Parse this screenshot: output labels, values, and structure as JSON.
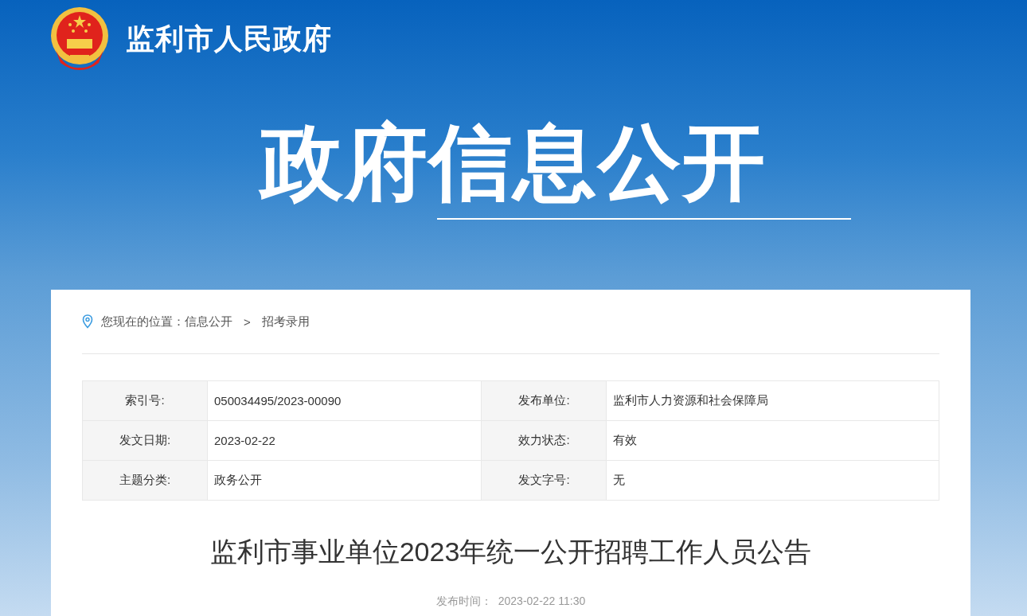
{
  "site": {
    "name": "监利市人民政府"
  },
  "banner": {
    "title": "政府信息公开"
  },
  "breadcrumb": {
    "prefix": "您现在的位置：",
    "items": [
      "信息公开",
      "招考录用"
    ],
    "separator": ">"
  },
  "meta": [
    [
      {
        "label": "索引号:",
        "value": "050034495/2023-00090"
      },
      {
        "label": "发布单位:",
        "value": "监利市人力资源和社会保障局"
      }
    ],
    [
      {
        "label": "发文日期:",
        "value": "2023-02-22"
      },
      {
        "label": "效力状态:",
        "value": "有效"
      }
    ],
    [
      {
        "label": "主题分类:",
        "value": "政务公开"
      },
      {
        "label": "发文字号:",
        "value": "无"
      }
    ]
  ],
  "article": {
    "title": "监利市事业单位2023年统一公开招聘工作人员公告",
    "publish_label": "发布时间：",
    "publish_time": "2023-02-22 11:30"
  }
}
